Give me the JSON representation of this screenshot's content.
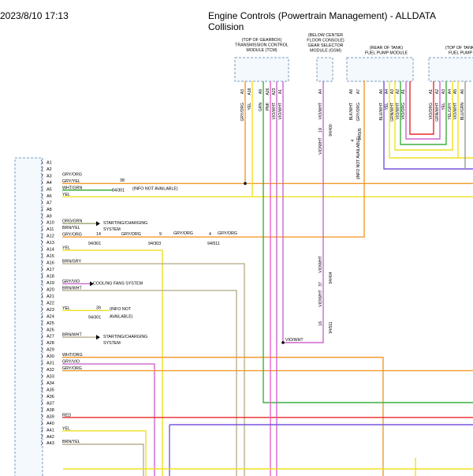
{
  "header": {
    "timestamp": "2023/8/10 17:13",
    "title": "Engine Controls (Powertrain Management) - ALLDATA Collision"
  },
  "modules": {
    "tcm": [
      "(TOP OF GEARBOX)",
      "TRANSMISSION CONTROL",
      "MODULE (TCM)"
    ],
    "gsm": [
      "(BELOW CENTER",
      "FLOOR CONSOLE)",
      "GEAR SELECTOR",
      "MODULE (GSM)"
    ],
    "fpm_rear": [
      "(REAR OF TANK)",
      "FUEL PUMP MODULE"
    ],
    "fpm_top": [
      "(TOP OF TANK)",
      "FUEL PUMP"
    ]
  },
  "pins": [
    "A1",
    "A2",
    "A3",
    "A4",
    "A5",
    "A6",
    "A7",
    "A8",
    "A9",
    "A10",
    "A11",
    "A12",
    "A13",
    "A14",
    "A15",
    "A16",
    "A17",
    "A18",
    "A19",
    "A20",
    "A21",
    "A22",
    "A23",
    "A24",
    "A25",
    "A26",
    "A27",
    "A28",
    "A29",
    "A30",
    "A31",
    "A32",
    "A33",
    "A34",
    "A35",
    "A36",
    "A37",
    "A38",
    "A39",
    "A40",
    "A41",
    "A42",
    "A43"
  ],
  "wire_labels": {
    "A3": "GRY/ORG",
    "A4": "GRY/YEL",
    "A5": "WHT/GRN",
    "A6": "YEL",
    "A10": "ORG/GRN",
    "A11": "BRN/YEL",
    "A12": "GRY/ORG",
    "A14": "YEL",
    "A16": "BRN/GRY",
    "A19": "GRY/VIO",
    "A20": "BRN/WHT",
    "A23": "YEL",
    "A27": "BRN/WHT",
    "A30": "WHT/ORG",
    "A31": "GRY/VIO",
    "A32": "GRY/ORG",
    "A39": "RED",
    "A41": "YEL",
    "A43": "BRN/YEL"
  },
  "annotations": {
    "a5_note": "(INFO NOT AVAILABLE)",
    "a24_note": [
      "(INFO NOT",
      "AVAILABLE)"
    ],
    "starting_a10": [
      "STARTING/CHARGING",
      "SYSTEM"
    ],
    "starting_a27": [
      "STARTING/CHARGING",
      "SYSTEM"
    ],
    "cooling": "COOLING FANS SYSTEM",
    "a12_mid": "GRY/ORG",
    "a12_right": "GRY/ORG",
    "vio_wht": "VIO/WHT",
    "info_vert": "(INFO NOT AVAILABLE)"
  },
  "refs": {
    "a4_num": "38",
    "a4_page": "94/301",
    "a12_n1": "14",
    "a12_p1": "94/301",
    "a12_n2": "9",
    "a12_p2": "94/303",
    "a12_n3": "4",
    "a12_p3": "94/511",
    "a24_num": "39",
    "a24_page": "94/301"
  },
  "tcm_pins": [
    {
      "pin": "A3",
      "color": "GRY/ORG"
    },
    {
      "pin": "A18",
      "color": "YEL"
    },
    {
      "pin": "A9",
      "color": "GRN"
    },
    {
      "pin": "A26",
      "color": "PNK"
    },
    {
      "pin": "A23",
      "color": "VIO/WHT"
    },
    {
      "pin": "A1",
      "color": "VIO/WHT"
    }
  ],
  "gsm_pins": [
    {
      "pin": "A4",
      "color": "VIO/WHT"
    }
  ],
  "fpm_pins": [
    {
      "pin": "A8",
      "color": "BLK/WHT"
    },
    {
      "pin": "A7",
      "color": "GRY/ORG"
    },
    {
      "pin": "A6",
      "color": "BLU/WHT"
    },
    {
      "pin": "A4",
      "color": "YEL"
    },
    {
      "pin": "A3",
      "color": "GRN/WHT"
    },
    {
      "pin": "A2",
      "color": "VIO/WHT"
    },
    {
      "pin": "A1",
      "color": "VIO/ORG"
    }
  ],
  "fpm2_pins": [
    {
      "pin": "A1",
      "color": "VIO/ORG"
    },
    {
      "pin": "A2",
      "color": "GRN/WHT"
    },
    {
      "pin": "A3",
      "color": "YEL"
    },
    {
      "pin": "A4",
      "color": "YEL/GRY"
    },
    {
      "pin": "A5",
      "color": "VIO/WHT"
    },
    {
      "pin": "A6",
      "color": "BLU/GRN"
    }
  ],
  "vertical_refs": {
    "gsm_top_num": "19",
    "gsm_top_page": "94/400",
    "gsm_mid_num": "37",
    "gsm_mid_page": "94/404",
    "gsm_bot_num": "16",
    "gsm_bot_page": "94/511",
    "fpm_num": "4",
    "fpm_page": "94/505"
  },
  "colors": {
    "orange": "#F29A2E",
    "yellow": "#F0E020",
    "green": "#3FAF3F",
    "pink": "#F060C8",
    "violet": "#7755DD",
    "violet_light": "#CC66CC",
    "blue": "#3366FF",
    "red": "#E8282A",
    "tan": "#B8AF8F",
    "gray": "#999999",
    "olive": "#9AA06A"
  }
}
